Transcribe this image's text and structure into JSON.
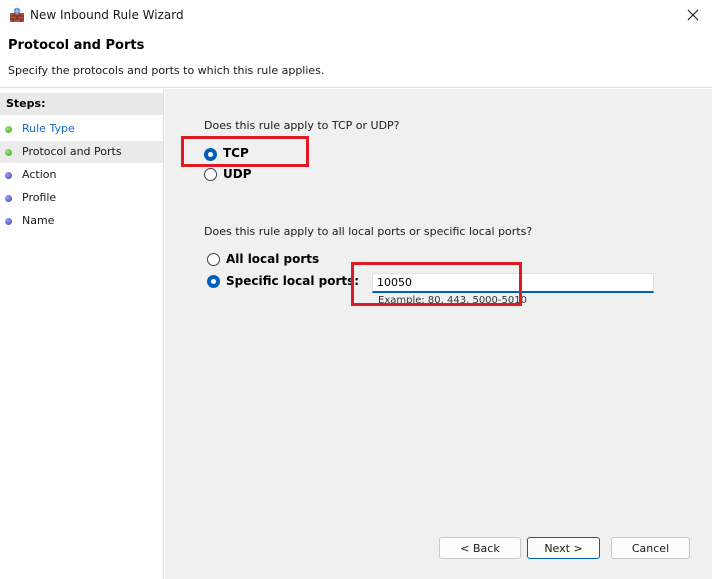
{
  "window": {
    "title": "New Inbound Rule Wizard",
    "icons": {
      "app": "firewall-wall-icon",
      "close": "close-icon"
    }
  },
  "header": {
    "title": "Protocol and Ports",
    "subtitle": "Specify the protocols and ports to which this rule applies."
  },
  "sidebar": {
    "steps_label": "Steps:",
    "items": [
      {
        "label": "Rule Type",
        "state": "done"
      },
      {
        "label": "Protocol and Ports",
        "state": "current"
      },
      {
        "label": "Action",
        "state": "pending"
      },
      {
        "label": "Profile",
        "state": "pending"
      },
      {
        "label": "Name",
        "state": "pending"
      }
    ]
  },
  "protocol": {
    "question": "Does this rule apply to TCP or UDP?",
    "options": [
      {
        "label": "TCP",
        "checked": true
      },
      {
        "label": "UDP",
        "checked": false
      }
    ]
  },
  "ports": {
    "question": "Does this rule apply to all local ports or specific local ports?",
    "options": [
      {
        "label": "All local ports",
        "checked": false
      },
      {
        "label": "Specific local ports:",
        "checked": true
      }
    ],
    "input_value": "10050",
    "example": "Example: 80, 443, 5000-5010"
  },
  "buttons": {
    "back": "< Back",
    "next": "Next >",
    "cancel": "Cancel"
  },
  "colors": {
    "accent": "#005fb8",
    "highlight": "#e01a22",
    "link": "#1a66c7",
    "step_done": "#3ea31b",
    "step_pending": "#3d45b8"
  }
}
